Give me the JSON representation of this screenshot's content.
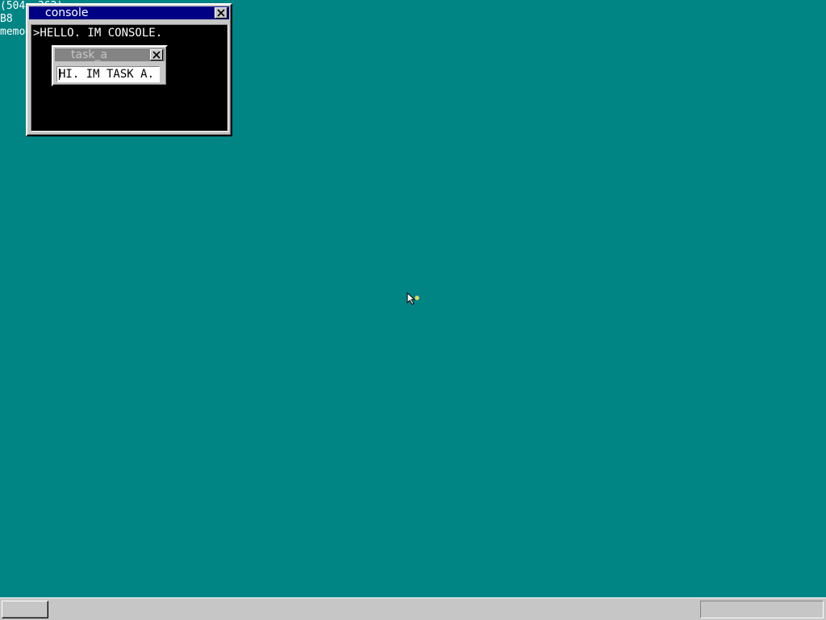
{
  "debug": {
    "mouse_pos": "(504, 362)",
    "key_code": "B8",
    "memory_label": "memo"
  },
  "console_window": {
    "title": "console",
    "text": ">HELLO. IM CONSOLE."
  },
  "task_a_window": {
    "title": "task_a",
    "textbox_value": "HI. IM TASK A."
  },
  "colors": {
    "desktop": "#008484",
    "active_titlebar": "#000084",
    "inactive_titlebar": "#848484",
    "window_face": "#c6c6c6"
  },
  "icons": {
    "close": "close-icon",
    "cursor": "mouse-cursor-icon"
  }
}
